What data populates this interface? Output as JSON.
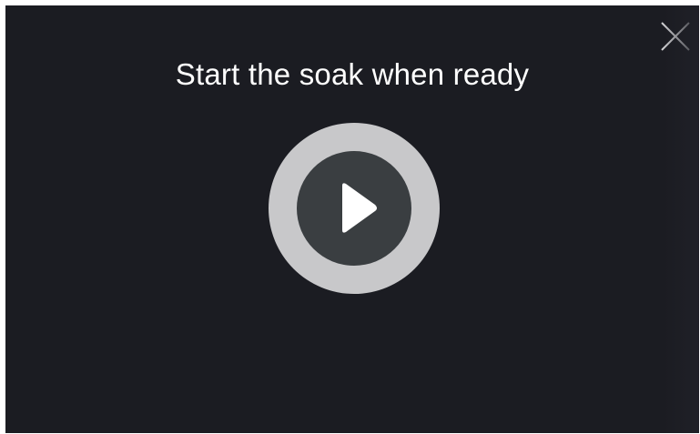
{
  "dialog": {
    "title": "Start the soak when ready",
    "background_color": "#1b1c22"
  },
  "close_button": {
    "icon": "close-icon",
    "color": "#cfcfd2"
  },
  "play_button": {
    "icon": "play-icon",
    "ring_color": "#c8c8ca",
    "fill_color": "#3a3e41",
    "icon_color": "#ffffff"
  }
}
